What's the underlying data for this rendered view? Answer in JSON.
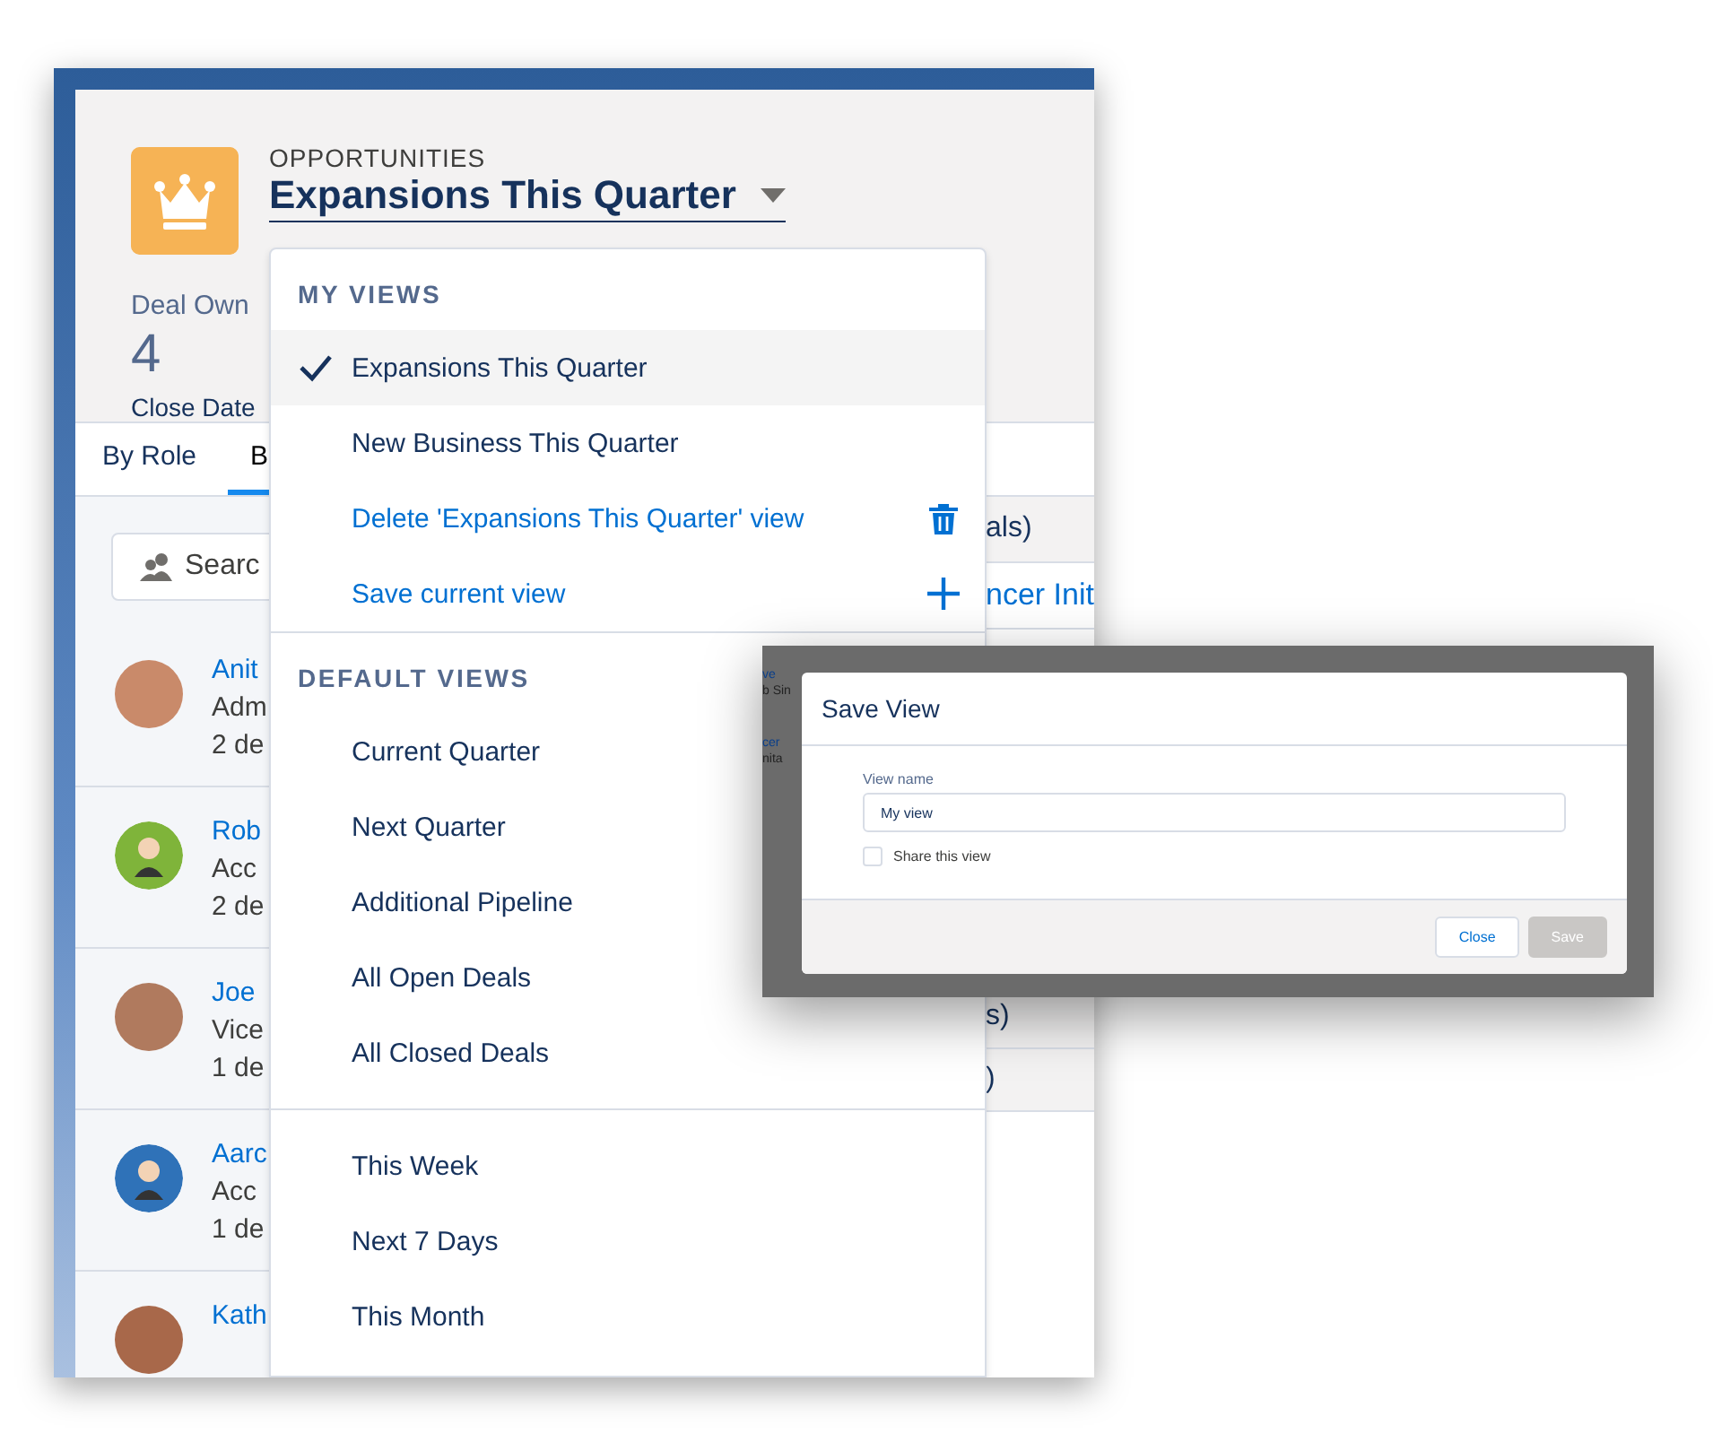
{
  "header": {
    "object_label": "OPPORTUNITIES",
    "title": "Expansions This Quarter",
    "fields": [
      {
        "kind": "label",
        "text": "Deal Own"
      },
      {
        "kind": "number",
        "text": "4"
      },
      {
        "kind": "caption",
        "text": "Close Date"
      }
    ]
  },
  "tabs": [
    {
      "label": "By Role",
      "selected": false
    },
    {
      "label": "B",
      "selected": true
    }
  ],
  "search": {
    "placeholder": "Searc"
  },
  "people": [
    {
      "kind": "photo",
      "color": "#c98a6a",
      "name": "Anit",
      "role": "Adm",
      "deals": "2 de"
    },
    {
      "kind": "cartoon",
      "color": "#7fb43a",
      "name": "Rob",
      "role": "Acc",
      "deals": "2 de"
    },
    {
      "kind": "photo",
      "color": "#b07a5e",
      "name": "Joe",
      "role": "Vice",
      "deals": "1 de"
    },
    {
      "kind": "cartoon",
      "color": "#2f72b8",
      "name": "Aarc",
      "role": "Acc",
      "deals": "1 de"
    },
    {
      "kind": "photo",
      "color": "#a8684a",
      "name": "Kath"
    }
  ],
  "table_fragments": [
    {
      "kind": "header",
      "text": "als)"
    },
    {
      "kind": "link",
      "text": "ncer Init"
    },
    {
      "kind": "gap"
    },
    {
      "kind": "row",
      "text": "s)"
    },
    {
      "kind": "row",
      "text": ")"
    }
  ],
  "dropdown": {
    "sections": [
      {
        "heading": "MY VIEWS",
        "items": [
          {
            "kind": "view",
            "label": "Expansions This Quarter",
            "selected": true
          },
          {
            "kind": "view",
            "label": "New Business This Quarter",
            "selected": false
          },
          {
            "kind": "delete",
            "label": "Delete 'Expansions This Quarter' view"
          },
          {
            "kind": "add",
            "label": "Save current view"
          }
        ]
      },
      {
        "heading": "DEFAULT VIEWS",
        "items": [
          {
            "kind": "view",
            "label": "Current Quarter",
            "selected": false
          },
          {
            "kind": "view",
            "label": "Next Quarter",
            "selected": false
          },
          {
            "kind": "view",
            "label": "Additional Pipeline",
            "selected": false
          },
          {
            "kind": "view",
            "label": "All Open Deals",
            "selected": false
          },
          {
            "kind": "view",
            "label": "All Closed Deals",
            "selected": false
          }
        ]
      },
      {
        "items": [
          {
            "kind": "view",
            "label": "This Week",
            "selected": false
          },
          {
            "kind": "view",
            "label": "Next 7 Days",
            "selected": false
          },
          {
            "kind": "view",
            "label": "This Month",
            "selected": false
          }
        ]
      }
    ]
  },
  "modal": {
    "background_fragments": [
      {
        "kind": "link",
        "text": "ve"
      },
      {
        "kind": "text",
        "text": "b Sin"
      },
      {
        "kind": "link",
        "text": "cer"
      },
      {
        "kind": "text",
        "text": "nita"
      }
    ],
    "title": "Save View",
    "field_label": "View name",
    "field_value": "My view",
    "checkbox": {
      "label": "Share this view",
      "checked": false
    },
    "buttons": [
      {
        "label": "Close",
        "disabled": false
      },
      {
        "label": "Save",
        "disabled": true
      }
    ]
  }
}
